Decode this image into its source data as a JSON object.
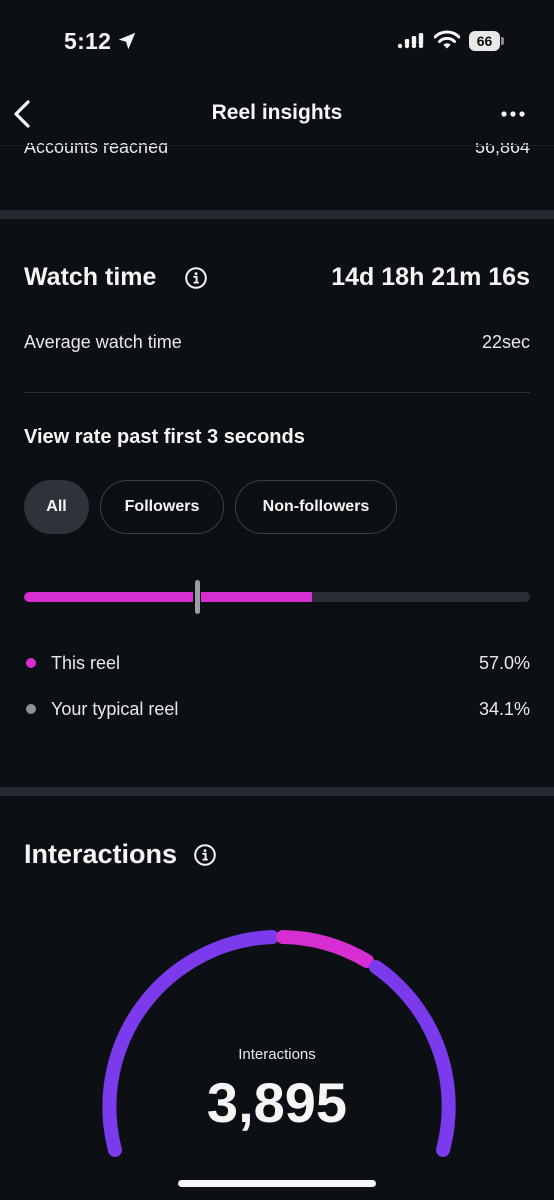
{
  "status_bar": {
    "time": "5:12",
    "battery": "66",
    "location_icon": "location-arrow-icon",
    "signal_icon": "cellular-signal-icon",
    "wifi_icon": "wifi-icon"
  },
  "header": {
    "title": "Reel insights",
    "back_icon": "chevron-left-icon",
    "more_icon": "more-horizontal-icon"
  },
  "reach_row": {
    "label": "Accounts reached",
    "value": "56,864"
  },
  "watch_time": {
    "title": "Watch time",
    "value": "14d 18h 21m 16s",
    "info_icon": "info-icon",
    "average_label": "Average watch time",
    "average_value": "22sec"
  },
  "view_rate": {
    "heading": "View rate past first 3 seconds",
    "filters": [
      {
        "label": "All",
        "active": true
      },
      {
        "label": "Followers",
        "active": false
      },
      {
        "label": "Non-followers",
        "active": false
      }
    ],
    "this_reel": {
      "label": "This reel",
      "value": "57.0%",
      "fraction": 0.57,
      "color": "#d62ed0"
    },
    "typical": {
      "label": "Your typical reel",
      "value": "34.1%",
      "fraction": 0.341,
      "color": "#8e9196"
    }
  },
  "interactions": {
    "title": "Interactions",
    "info_icon": "info-icon",
    "gauge_label": "Interactions",
    "total": "3,895",
    "colors": {
      "primary": "#7c3aed",
      "secondary": "#d62ed0"
    }
  }
}
